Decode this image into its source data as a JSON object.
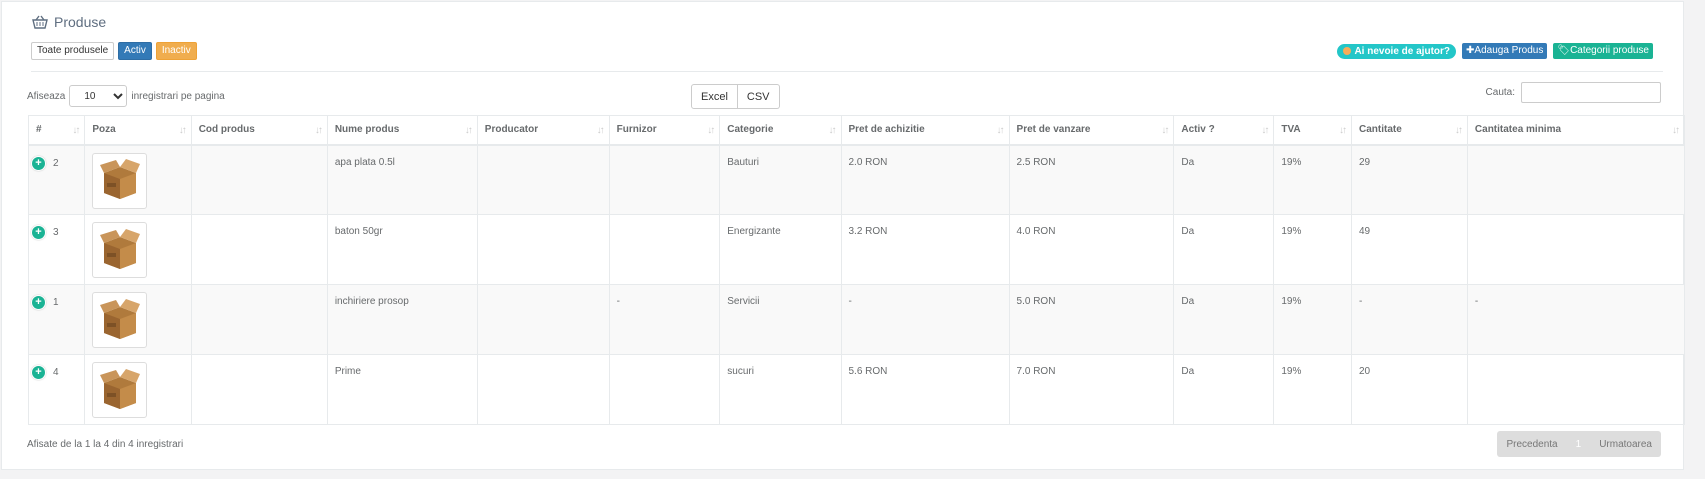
{
  "page": {
    "title": "Produse",
    "title_icon": "basket-icon"
  },
  "filters": [
    "Toate produsele",
    "Activ",
    "Inactiv"
  ],
  "actions": {
    "help": "Ai nevoie de ajutor?",
    "add_product": "Adauga Produs",
    "categories": "Categorii produse"
  },
  "length": {
    "prefix": "Afiseaza",
    "value": "10",
    "suffix": "inregistrari pe pagina"
  },
  "export": {
    "excel": "Excel",
    "csv": "CSV"
  },
  "search": {
    "label": "Cauta:",
    "value": ""
  },
  "table": {
    "columns": [
      "#",
      "Poza",
      "Cod produs",
      "Nume produs",
      "Producator",
      "Furnizor",
      "Categorie",
      "Pret de achizitie",
      "Pret de vanzare",
      "Activ ?",
      "TVA",
      "Cantitate",
      "Cantitatea minima"
    ],
    "rows": [
      {
        "id": "2",
        "cod": "",
        "nume": "apa plata 0.5l",
        "producator": "",
        "furnizor": "",
        "categorie": "Bauturi",
        "achizitie": "2.0 RON",
        "vanzare": "2.5 RON",
        "activ": "Da",
        "tva": "19%",
        "cantitate": "29",
        "minima": ""
      },
      {
        "id": "3",
        "cod": "",
        "nume": "baton 50gr",
        "producator": "",
        "furnizor": "",
        "categorie": "Energizante",
        "achizitie": "3.2 RON",
        "vanzare": "4.0 RON",
        "activ": "Da",
        "tva": "19%",
        "cantitate": "49",
        "minima": ""
      },
      {
        "id": "1",
        "cod": "",
        "nume": "inchiriere prosop",
        "producator": "",
        "furnizor": "-",
        "categorie": "Servicii",
        "achizitie": "-",
        "vanzare": "5.0 RON",
        "activ": "Da",
        "tva": "19%",
        "cantitate": "-",
        "minima": "-"
      },
      {
        "id": "4",
        "cod": "",
        "nume": "Prime",
        "producator": "",
        "furnizor": "",
        "categorie": "sucuri",
        "achizitie": "5.6 RON",
        "vanzare": "7.0 RON",
        "activ": "Da",
        "tva": "19%",
        "cantitate": "20",
        "minima": ""
      }
    ]
  },
  "footer": {
    "info": "Afisate de la 1 la 4 din 4 inregistrari",
    "prev": "Precedenta",
    "page": "1",
    "next": "Urmatoarea"
  }
}
